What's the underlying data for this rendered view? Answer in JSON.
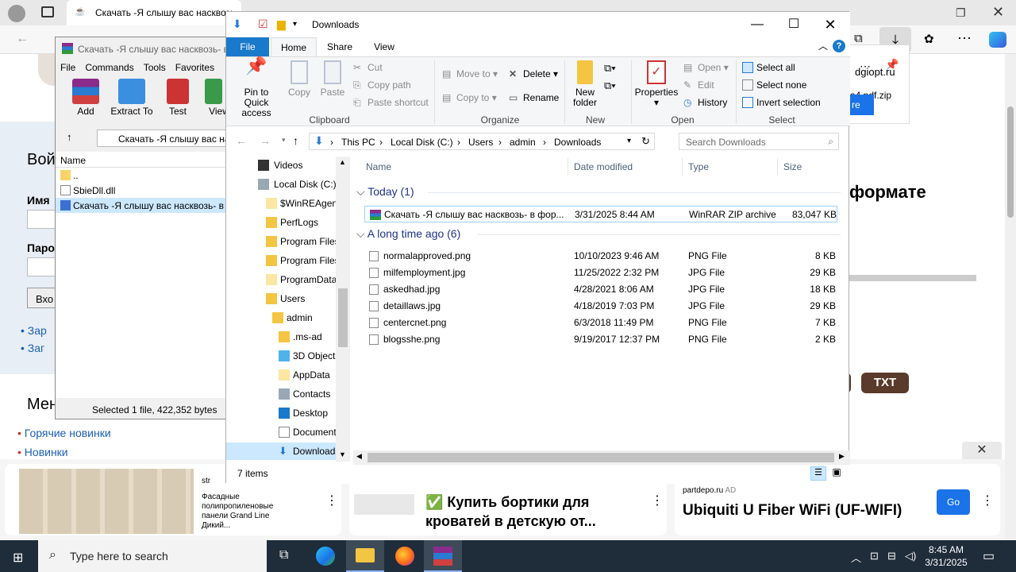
{
  "browser": {
    "tab_title": "Скачать -Я слышу вас насквозь- в ф",
    "url_host": "dgiopt.ru",
    "download_file": "a4.pdf.zip",
    "download_btn": "re"
  },
  "page": {
    "left_heading": "Вой",
    "name_label": "Имя",
    "pass_label": "Паро",
    "login_btn": "Вхо",
    "links": [
      "Зар",
      "Заг"
    ],
    "menu_heading": "Мен",
    "news_links": [
      "Горячие новинки",
      "Новинки"
    ],
    "right_heading": "формате",
    "txt_badge": "TXT"
  },
  "ads": [
    {
      "source": "str",
      "text": "Фасадные полипропиленовые панели Grand Line Дикий..."
    },
    {
      "text": "✅ Купить бортики для кроватей в детскую от..."
    },
    {
      "source": "partdepo.ru",
      "ad_tag": "AD",
      "text": "Ubiquiti U Fiber WiFi (UF-WIFI)",
      "button": "Go"
    }
  ],
  "winrar": {
    "title": "Скачать -Я слышу вас насквозь- в",
    "menu": [
      "File",
      "Commands",
      "Tools",
      "Favorites"
    ],
    "tools": [
      "Add",
      "Extract To",
      "Test",
      "View"
    ],
    "path": "Скачать -Я слышу вас на",
    "col_name": "Name",
    "rows": [
      "..",
      "SbieDll.dll",
      "Скачать -Я слышу вас насквозь- в"
    ],
    "status": "Selected 1 file, 422,352 bytes"
  },
  "explorer": {
    "title": "Downloads",
    "tabs": {
      "file": "File",
      "home": "Home",
      "share": "Share",
      "view": "View"
    },
    "ribbon": {
      "pin": "Pin to Quick access",
      "copy": "Copy",
      "paste": "Paste",
      "cut": "Cut",
      "copy_path": "Copy path",
      "paste_shortcut": "Paste shortcut",
      "clipboard": "Clipboard",
      "move_to": "Move to",
      "copy_to": "Copy to",
      "delete": "Delete",
      "rename": "Rename",
      "organize": "Organize",
      "new_folder": "New folder",
      "new": "New",
      "properties": "Properties",
      "open": "Open",
      "edit": "Edit",
      "history": "History",
      "open_group": "Open",
      "select_all": "Select all",
      "select_none": "Select none",
      "invert_selection": "Invert selection",
      "select": "Select"
    },
    "breadcrumb": [
      "This PC",
      "Local Disk (C:)",
      "Users",
      "admin",
      "Downloads"
    ],
    "search_placeholder": "Search Downloads",
    "nav": [
      "Videos",
      "Local Disk (C:)",
      "$WinREAgent",
      "PerfLogs",
      "Program Files",
      "Program Files",
      "ProgramData",
      "Users",
      "admin",
      ".ms-ad",
      "3D Objects",
      "AppData",
      "Contacts",
      "Desktop",
      "Documents",
      "Downloads"
    ],
    "columns": {
      "name": "Name",
      "date": "Date modified",
      "type": "Type",
      "size": "Size"
    },
    "group_today": "Today (1)",
    "group_old": "A long time ago (6)",
    "today_files": [
      {
        "name": "Скачать -Я слышу вас насквозь- в фор...",
        "date": "3/31/2025 8:44 AM",
        "type": "WinRAR ZIP archive",
        "size": "83,047 KB"
      }
    ],
    "old_files": [
      {
        "name": "normalapproved.png",
        "date": "10/10/2023 9:46 AM",
        "type": "PNG File",
        "size": "8 KB"
      },
      {
        "name": "milfemployment.jpg",
        "date": "11/25/2022 2:32 PM",
        "type": "JPG File",
        "size": "29 KB"
      },
      {
        "name": "askedhad.jpg",
        "date": "4/28/2021 8:06 AM",
        "type": "JPG File",
        "size": "18 KB"
      },
      {
        "name": "detaillaws.jpg",
        "date": "4/18/2019 7:03 PM",
        "type": "JPG File",
        "size": "29 KB"
      },
      {
        "name": "centercnet.png",
        "date": "6/3/2018 11:49 PM",
        "type": "PNG File",
        "size": "7 KB"
      },
      {
        "name": "blogsshe.png",
        "date": "9/19/2017 12:37 PM",
        "type": "PNG File",
        "size": "2 KB"
      }
    ],
    "status": "7 items"
  },
  "taskbar": {
    "search_placeholder": "Type here to search",
    "time": "8:45 AM",
    "date": "3/31/2025"
  }
}
